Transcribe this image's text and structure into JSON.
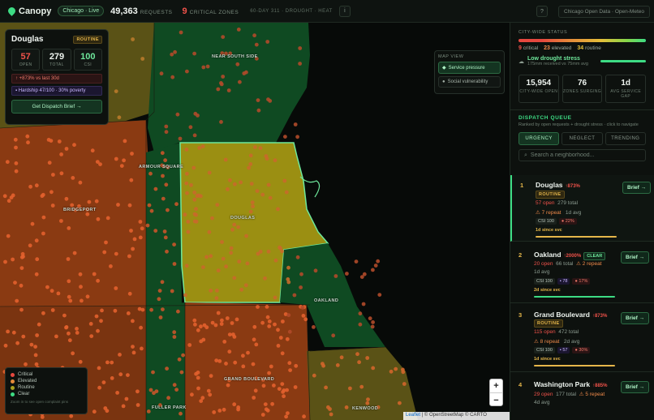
{
  "header": {
    "brand": "Canopy",
    "live_pill": "Chicago · Live",
    "requests_count": "49,363",
    "requests_label": "REQUESTS",
    "critical_count": "9",
    "critical_label": "CRITICAL ZONES",
    "window_label": "60-DAY 311 · DROUGHT · HEAT",
    "info_icon": "i",
    "help_icon": "?",
    "source": "Chicago Open Data · Open-Meteo"
  },
  "map": {
    "labels": {
      "near_south_side": "NEAR SOUTH SIDE",
      "armour_square": "ARMOUR SQUARE",
      "bridgeport": "BRIDGEPORT",
      "douglas": "DOUGLAS",
      "oakland": "OAKLAND",
      "grand_boulevard": "GRAND BOULEVARD",
      "fuller_park": "FULLER PARK",
      "kenwood": "KENWOOD"
    },
    "colors": {
      "critical": "#e5483f",
      "elevated": "#e58a3a",
      "routine": "#8f8a2a",
      "clear": "#3ddc84",
      "selected": "#a9a01e",
      "green_zone": "#0f4a22"
    },
    "popup": {
      "title": "Douglas",
      "tag": "ROUTINE",
      "stats": [
        {
          "value": "57",
          "label": "OPEN",
          "color": "#f0524a"
        },
        {
          "value": "279",
          "label": "TOTAL",
          "color": "#eef4ef"
        },
        {
          "value": "100",
          "label": "CSI",
          "color": "#6ee79b"
        }
      ],
      "trend": "↑ +873% vs last 30d",
      "hardship": "Hardship 47/100 · 30% poverty",
      "button": "Get Dispatch Brief →"
    },
    "mapview": {
      "title": "MAP VIEW",
      "options": [
        "Service pressure",
        "Social vulnerability"
      ]
    },
    "legend": {
      "items": [
        {
          "label": "Critical",
          "color": "#e5483f"
        },
        {
          "label": "Elevated",
          "color": "#e58a3a"
        },
        {
          "label": "Routine",
          "color": "#a9a01e"
        },
        {
          "label": "Clear",
          "color": "#3ddc84"
        }
      ],
      "note": "Zoom in to see open complaint pins"
    },
    "zoom": {
      "in": "+",
      "out": "−"
    },
    "attribution": {
      "leaflet": "Leaflet",
      "rest": " | © OpenStreetMap © CARTO"
    }
  },
  "panel": {
    "status_title": "CITY-WIDE STATUS",
    "counts": {
      "critical": "9",
      "critical_label": "critical",
      "elevated": "23",
      "elevated_label": "elevated",
      "routine": "34",
      "routine_label": "routine"
    },
    "drought": {
      "title": "Low drought stress",
      "sub": "175mm received vs 75mm avg"
    },
    "cards": [
      {
        "value": "15,954",
        "label": "CITY-WIDE OPEN"
      },
      {
        "value": "76",
        "label": "ZONES SURGING"
      },
      {
        "value": "1d",
        "label": "AVG SERVICE GAP"
      }
    ],
    "dispatch_title": "DISPATCH QUEUE",
    "dispatch_sub": "Ranked by open requests + drought stress · click to navigate",
    "tabs": [
      "URGENCY",
      "NEGLECT",
      "TRENDING"
    ],
    "search_placeholder": "Search a neighborhood...",
    "queue": [
      {
        "rank": "1",
        "name": "Douglas",
        "pct": "↑873%",
        "tag": "ROUTINE",
        "open": "57 open",
        "total": "279 total",
        "repeat": "⚠ 7 repeat",
        "avg": "1d avg",
        "csi": "CSI 100",
        "vp": "",
        "poverty": "22%",
        "since": "1d since svc"
      },
      {
        "rank": "2",
        "name": "Oakland",
        "pct": "↑2000%",
        "tag": "CLEAR",
        "open": "20 open",
        "total": "66 total",
        "repeat": "⚠ 2 repeat",
        "avg": "1d avg",
        "csi": "CSI 100",
        "vp": "78",
        "poverty": "17%",
        "since": "2d since svc"
      },
      {
        "rank": "3",
        "name": "Grand Boulevard",
        "pct": "↑873%",
        "tag": "ROUTINE",
        "open": "115 open",
        "total": "472 total",
        "repeat": "⚠ 8 repeat",
        "avg": "2d avg",
        "csi": "CSI 100",
        "vp": "57",
        "poverty": "30%",
        "since": "1d since svc"
      },
      {
        "rank": "4",
        "name": "Washington Park",
        "pct": "↑885%",
        "tag": "",
        "open": "29 open",
        "total": "177 total",
        "repeat": "⚠ 5 repeat",
        "avg": "4d avg",
        "csi": "",
        "vp": "",
        "poverty": "",
        "since": ""
      }
    ],
    "brief_label": "Brief →"
  }
}
